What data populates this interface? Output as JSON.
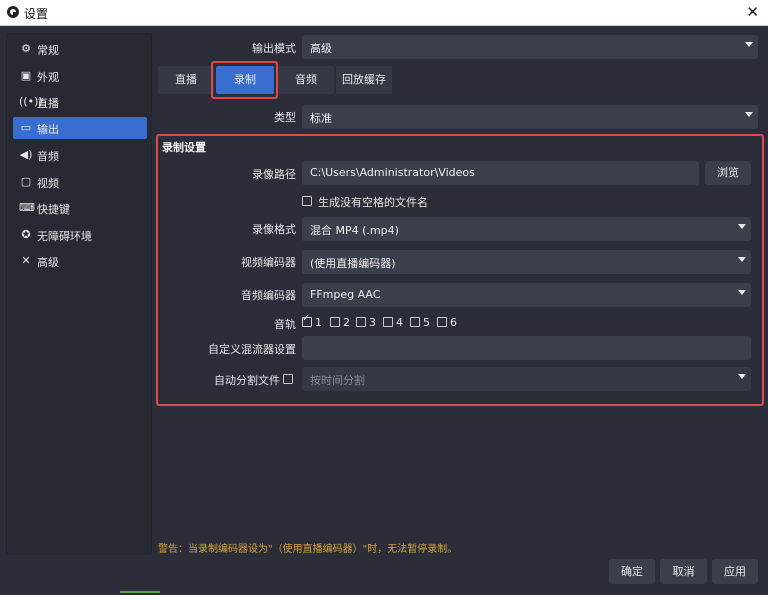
{
  "window": {
    "title": "设置",
    "close_glyph": "✕"
  },
  "sidebar": {
    "items": [
      {
        "label": "常规",
        "icon": "gear-icon"
      },
      {
        "label": "外观",
        "icon": "appearance-icon"
      },
      {
        "label": "直播",
        "icon": "broadcast-icon"
      },
      {
        "label": "输出",
        "icon": "output-icon",
        "active": true
      },
      {
        "label": "音频",
        "icon": "speaker-icon"
      },
      {
        "label": "视频",
        "icon": "monitor-icon"
      },
      {
        "label": "快捷键",
        "icon": "keyboard-icon"
      },
      {
        "label": "无障碍环境",
        "icon": "accessibility-icon"
      },
      {
        "label": "高级",
        "icon": "wrench-icon"
      }
    ]
  },
  "output_mode": {
    "label": "输出模式",
    "value": "高级"
  },
  "tabs": [
    {
      "label": "直播"
    },
    {
      "label": "录制",
      "active": true
    },
    {
      "label": "音频"
    },
    {
      "label": "回放缓存"
    }
  ],
  "type": {
    "label": "类型",
    "value": "标准"
  },
  "recording": {
    "section_title": "录制设置",
    "path_label": "录像路径",
    "path_value": "C:\\Users\\Administrator\\Videos",
    "browse_label": "浏览",
    "no_space_label": "生成没有空格的文件名",
    "format_label": "录像格式",
    "format_value": "混合 MP4 (.mp4)",
    "video_encoder_label": "视频编码器",
    "video_encoder_value": "(使用直播编码器)",
    "audio_encoder_label": "音频编码器",
    "audio_encoder_value": "FFmpeg AAC",
    "tracks_label": "音轨",
    "tracks": [
      {
        "n": "1",
        "checked": true
      },
      {
        "n": "2",
        "checked": false
      },
      {
        "n": "3",
        "checked": false
      },
      {
        "n": "4",
        "checked": false
      },
      {
        "n": "5",
        "checked": false
      },
      {
        "n": "6",
        "checked": false
      }
    ],
    "muxer_label": "自定义混流器设置",
    "muxer_value": "",
    "autosplit_label": "自动分割文件",
    "autosplit_value": "按时间分割"
  },
  "warning": "警告：当录制编码器设为\"（使用直播编码器）\"时，无法暂停录制。",
  "buttons": {
    "ok": "确定",
    "cancel": "取消",
    "apply": "应用"
  },
  "colors": {
    "accent": "#3a6dd0",
    "highlight": "#e04a4a",
    "warning": "#d5a23b"
  }
}
